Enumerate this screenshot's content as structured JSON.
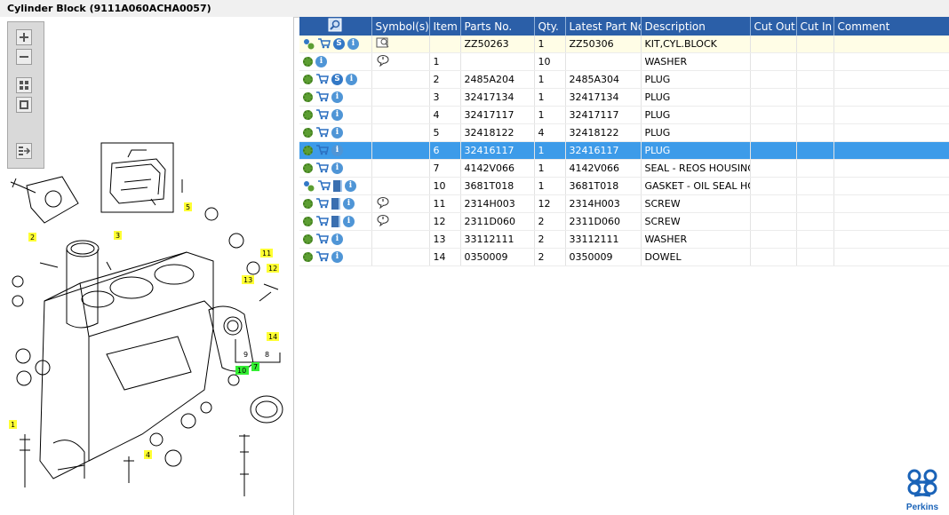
{
  "window": {
    "title": "Cylinder Block (9111A060ACHA0057)"
  },
  "toolbar": {
    "buttons": [
      "zoom-in",
      "zoom-out",
      "fit-all",
      "fit-window",
      "export"
    ]
  },
  "diagram": {
    "callouts": [
      "1",
      "2",
      "3",
      "4",
      "5",
      "7",
      "8",
      "9",
      "10",
      "11",
      "12",
      "13",
      "14"
    ],
    "callout_color_yellow": "#ffff33",
    "callout_color_green": "#33ee33"
  },
  "grid": {
    "columns": [
      "",
      "Symbol(s)",
      "Item",
      "Parts No.",
      "Qty.",
      "Latest Part No.",
      "Description",
      "Cut Out",
      "Cut In",
      "Comment"
    ],
    "header_color": "#2b5fa8",
    "selected_color": "#3d9be9",
    "rows": [
      {
        "icons": "gear2,cart,s,info",
        "symbol": "book-search",
        "item": "",
        "part": "ZZ50263",
        "qty": "1",
        "latest": "ZZ50306",
        "desc": "KIT,CYL.BLOCK",
        "kit": true
      },
      {
        "icons": "gear,info",
        "symbol": "bubble",
        "item": "1",
        "part": "",
        "qty": "10",
        "latest": "",
        "desc": "WASHER"
      },
      {
        "icons": "gear,cart,s,info",
        "symbol": "",
        "item": "2",
        "part": "2485A204",
        "qty": "1",
        "latest": "2485A304",
        "desc": "PLUG"
      },
      {
        "icons": "gear,cart,info",
        "symbol": "",
        "item": "3",
        "part": "32417134",
        "qty": "1",
        "latest": "32417134",
        "desc": "PLUG"
      },
      {
        "icons": "gear,cart,info",
        "symbol": "",
        "item": "4",
        "part": "32417117",
        "qty": "1",
        "latest": "32417117",
        "desc": "PLUG"
      },
      {
        "icons": "gear,cart,info",
        "symbol": "",
        "item": "5",
        "part": "32418122",
        "qty": "4",
        "latest": "32418122",
        "desc": "PLUG"
      },
      {
        "icons": "gear,cart,info",
        "symbol": "",
        "item": "6",
        "part": "32416117",
        "qty": "1",
        "latest": "32416117",
        "desc": "PLUG",
        "selected": true
      },
      {
        "icons": "gear,cart,info",
        "symbol": "",
        "item": "7",
        "part": "4142V066",
        "qty": "1",
        "latest": "4142V066",
        "desc": "SEAL - REOS HOUSING"
      },
      {
        "icons": "gear2,cart,book,info",
        "symbol": "",
        "item": "10",
        "part": "3681T018",
        "qty": "1",
        "latest": "3681T018",
        "desc": "GASKET - OIL SEAL HOU"
      },
      {
        "icons": "gear,cart,book,info",
        "symbol": "bubble",
        "item": "11",
        "part": "2314H003",
        "qty": "12",
        "latest": "2314H003",
        "desc": "SCREW"
      },
      {
        "icons": "gear,cart,book,info",
        "symbol": "bubble",
        "item": "12",
        "part": "2311D060",
        "qty": "2",
        "latest": "2311D060",
        "desc": "SCREW"
      },
      {
        "icons": "gear,cart,info",
        "symbol": "",
        "item": "13",
        "part": "33112111",
        "qty": "2",
        "latest": "33112111",
        "desc": "WASHER"
      },
      {
        "icons": "gear,cart,info",
        "symbol": "",
        "item": "14",
        "part": "0350009",
        "qty": "2",
        "latest": "0350009",
        "desc": "DOWEL"
      }
    ]
  },
  "brand": {
    "name": "Perkins",
    "color": "#1a63b8"
  }
}
